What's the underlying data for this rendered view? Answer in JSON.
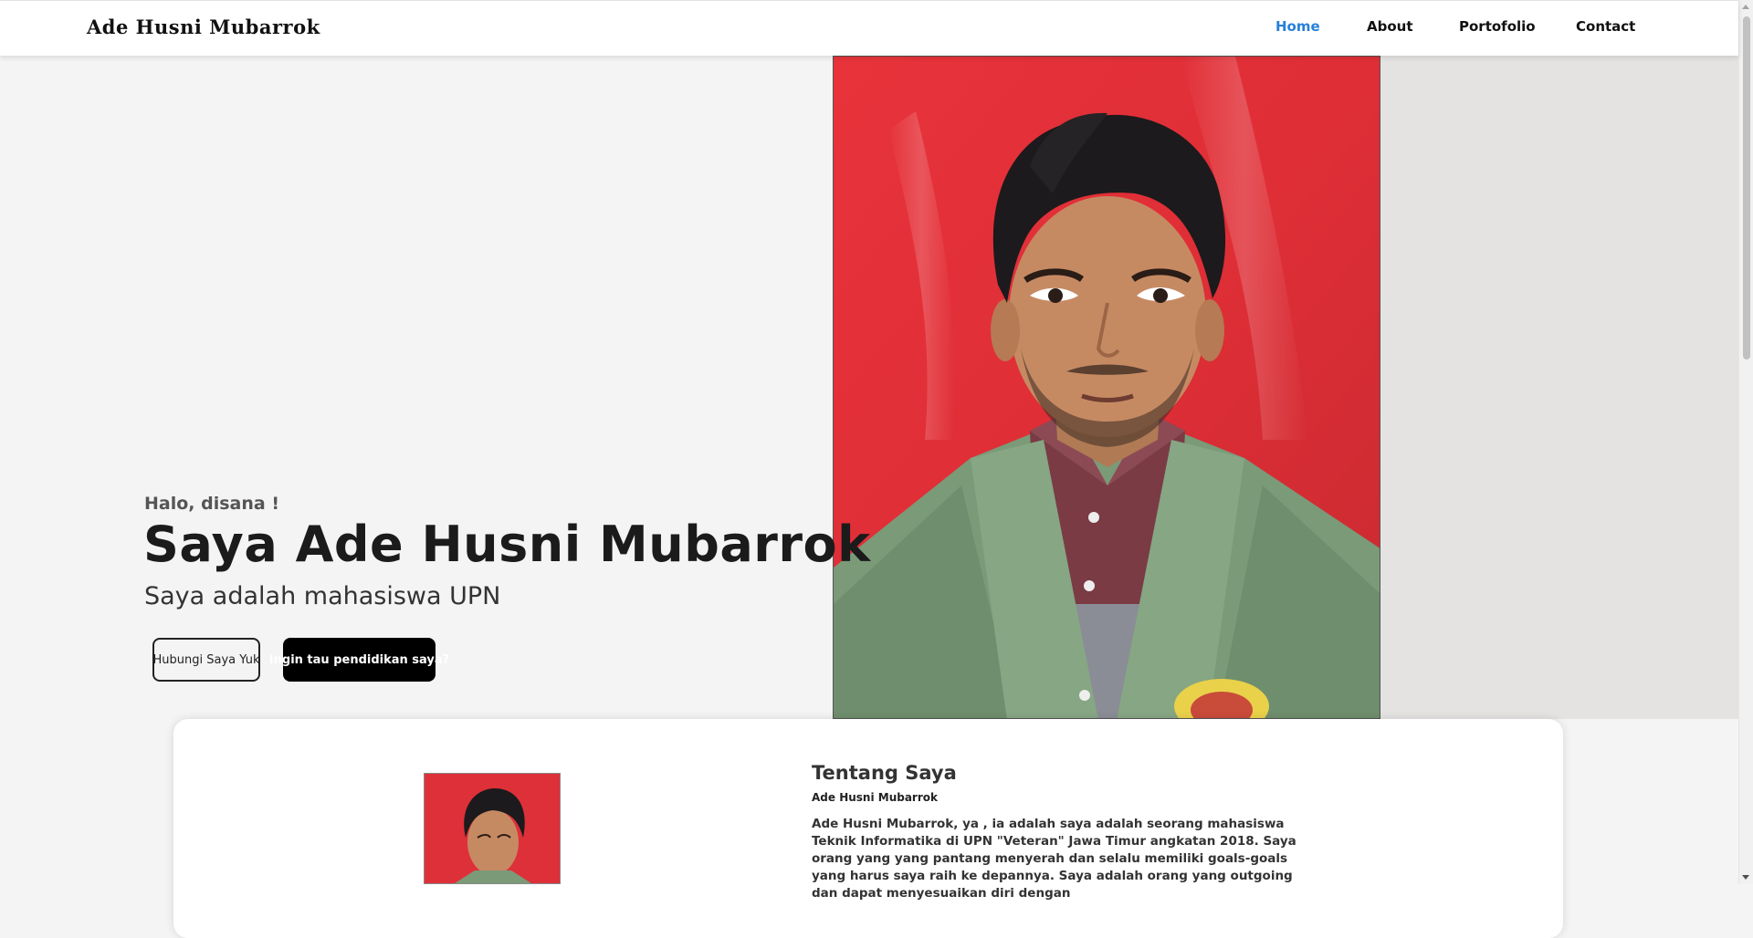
{
  "header": {
    "brand": "Ade Husni Mubarrok",
    "nav": [
      {
        "label": "Home",
        "active": true
      },
      {
        "label": "About"
      },
      {
        "label": "Portofolio"
      },
      {
        "label": "Contact"
      }
    ],
    "active_color": "#2680d9"
  },
  "hero": {
    "greeting": "Halo, disana !",
    "title": "Saya Ade Husni Mubarrok",
    "subtitle": "Saya adalah mahasiswa UPN",
    "buttons": {
      "contact": "Hubungi Saya Yuk",
      "education": "Ingin tau pendidikan saya?"
    },
    "photo": "portrait-photo"
  },
  "about": {
    "heading": "Tentang Saya",
    "name": "Ade Husni Mubarrok",
    "text": "Ade Husni Mubarrok, ya , ia adalah saya adalah seorang mahasiswa Teknik Informatika di UPN \"Veteran\" Jawa Timur angkatan 2018. Saya orang yang yang pantang menyerah dan selalu memiliki goals-goals yang harus saya raih ke depannya. Saya adalah orang yang outgoing dan dapat menyesuaikan diri dengan"
  }
}
